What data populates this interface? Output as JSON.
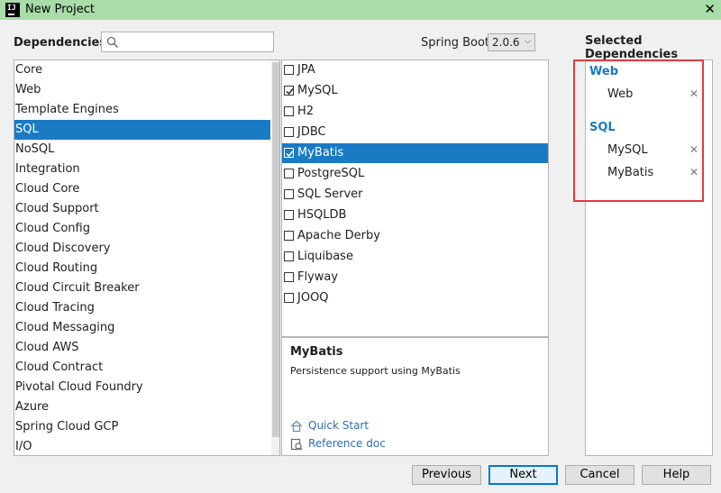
{
  "window": {
    "title": "New Project"
  },
  "header": {
    "dependencies_label": "Dependencies",
    "search": {
      "value": "",
      "placeholder": ""
    },
    "spring_boot_label": "Spring Boot",
    "spring_boot_version": "2.0.6"
  },
  "categories": [
    "Core",
    "Web",
    "Template Engines",
    "SQL",
    "NoSQL",
    "Integration",
    "Cloud Core",
    "Cloud Support",
    "Cloud Config",
    "Cloud Discovery",
    "Cloud Routing",
    "Cloud Circuit Breaker",
    "Cloud Tracing",
    "Cloud Messaging",
    "Cloud AWS",
    "Cloud Contract",
    "Pivotal Cloud Foundry",
    "Azure",
    "Spring Cloud GCP",
    "I/O"
  ],
  "selected_category": "SQL",
  "dependencies": [
    {
      "label": "JPA",
      "checked": false
    },
    {
      "label": "MySQL",
      "checked": true
    },
    {
      "label": "H2",
      "checked": false
    },
    {
      "label": "JDBC",
      "checked": false
    },
    {
      "label": "MyBatis",
      "checked": true
    },
    {
      "label": "PostgreSQL",
      "checked": false
    },
    {
      "label": "SQL Server",
      "checked": false
    },
    {
      "label": "HSQLDB",
      "checked": false
    },
    {
      "label": "Apache Derby",
      "checked": false
    },
    {
      "label": "Liquibase",
      "checked": false
    },
    {
      "label": "Flyway",
      "checked": false
    },
    {
      "label": "JOOQ",
      "checked": false
    }
  ],
  "selected_dependency": "MyBatis",
  "description": {
    "title": "MyBatis",
    "text": "Persistence support using MyBatis",
    "quick_start": "Quick Start",
    "reference_doc": "Reference doc"
  },
  "selected_panel": {
    "title": "Selected Dependencies",
    "groups": [
      {
        "name": "Web",
        "items": [
          "Web"
        ]
      },
      {
        "name": "SQL",
        "items": [
          "MySQL",
          "MyBatis"
        ]
      }
    ]
  },
  "buttons": {
    "previous": "Previous",
    "next": "Next",
    "cancel": "Cancel",
    "help": "Help"
  },
  "colors": {
    "titlebar": "#a8dca8",
    "selection": "#1a7ac4",
    "highlight_box": "#e23a3a",
    "link": "#2a6fb5"
  }
}
